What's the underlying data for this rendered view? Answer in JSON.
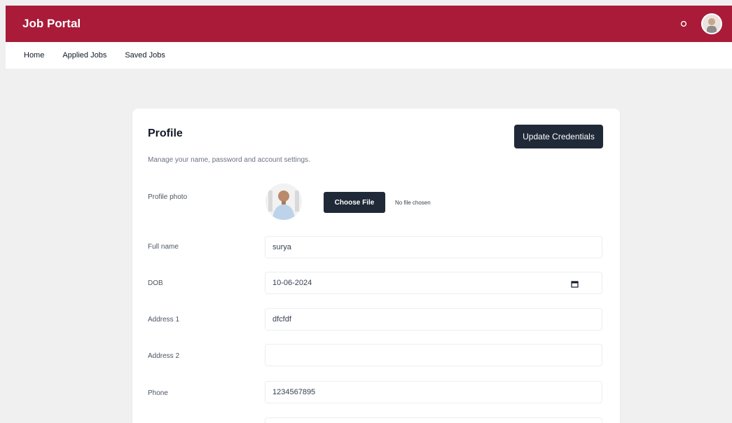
{
  "app": {
    "title": "Job Portal"
  },
  "nav": [
    {
      "label": "Home"
    },
    {
      "label": "Applied Jobs"
    },
    {
      "label": "Saved Jobs"
    }
  ],
  "profile": {
    "title": "Profile",
    "subtitle": "Manage your name, password and account settings.",
    "update_button": "Update Credentials",
    "photo": {
      "label": "Profile photo",
      "button": "Choose File",
      "status": "No file chosen"
    },
    "fields": {
      "full_name": {
        "label": "Full name",
        "value": "surya"
      },
      "dob": {
        "label": "DOB",
        "value": "10-06-2024"
      },
      "address1": {
        "label": "Address 1",
        "value": "dfcfdf"
      },
      "address2": {
        "label": "Address 2",
        "value": ""
      },
      "phone": {
        "label": "Phone",
        "value": "1234567895"
      }
    }
  },
  "colors": {
    "header": "#a91b38",
    "button": "#1f2937",
    "background": "#f0f0f0"
  },
  "icons": {
    "notifications": "bell-icon",
    "calendar": "calendar-icon",
    "user": "avatar"
  }
}
